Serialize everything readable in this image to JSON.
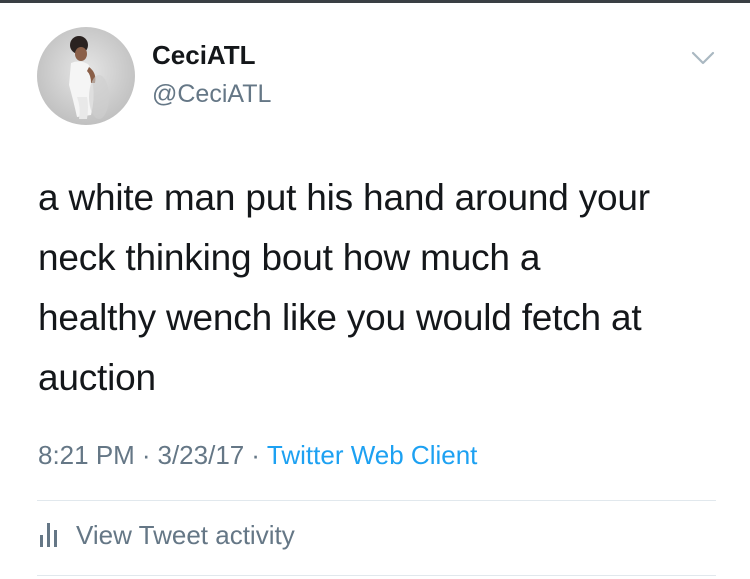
{
  "tweet": {
    "display_name": "CeciATL",
    "handle": "@CeciATL",
    "text_lines": [
      "a white man put his hand around your",
      "neck thinking bout how much a",
      "healthy wench like you would fetch at",
      "auction"
    ],
    "time": "8:21 PM",
    "separator": "·",
    "date": "3/23/17",
    "client": "Twitter Web Client",
    "activity_label": "View Tweet activity"
  },
  "icons": {
    "menu": "chevron-down-icon",
    "activity": "bar-chart-icon"
  },
  "colors": {
    "text": "#14171a",
    "secondary": "#657786",
    "link": "#1da1f2",
    "divider": "#e1e8ed"
  }
}
